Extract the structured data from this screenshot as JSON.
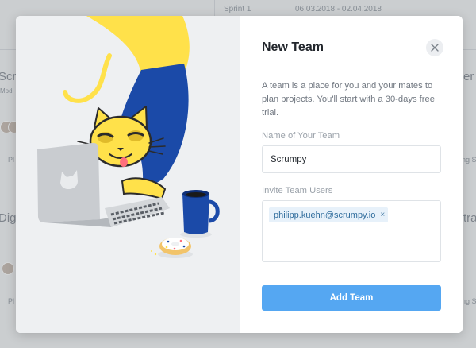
{
  "background": {
    "sprint_label": "Sprint 1",
    "sprint_dates": "06.03.2018 - 02.04.2018",
    "left_texts": [
      "Scr",
      "Mod",
      "Dig",
      "Pl",
      "Pl"
    ],
    "right_texts": [
      "er",
      "tra",
      "ing Sp",
      "ing Sp"
    ]
  },
  "modal": {
    "title": "New Team",
    "description": "A team is a place for you and your mates to plan projects. You'll start with a 30-days free trial.",
    "name_field": {
      "label": "Name of Your Team",
      "value": "Scrumpy"
    },
    "invite_field": {
      "label": "Invite Team Users",
      "tags": [
        {
          "email": "philipp.kuehn@scrumpy.io",
          "remove_symbol": "×"
        }
      ]
    },
    "submit_label": "Add Team"
  },
  "icons": {
    "close": "close-icon",
    "tag_remove": "remove-tag-icon"
  },
  "colors": {
    "accent": "#55a7f2",
    "tag_background": "#e7f1fa",
    "tag_text": "#2f6c9c",
    "illustration_blue": "#1b4aa8",
    "illustration_yellow": "#ffe14a"
  }
}
